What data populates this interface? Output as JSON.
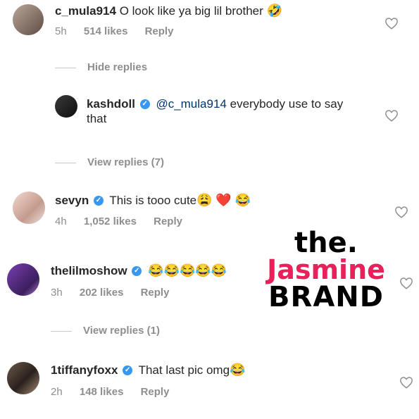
{
  "comments": [
    {
      "username": "c_mula914",
      "verified": false,
      "text": "O look like ya big lil brother",
      "emojis": [
        "🤣"
      ],
      "time": "5h",
      "likes": "514 likes",
      "reply": "Reply"
    },
    {
      "username": "kashdoll",
      "verified": true,
      "mention": "@c_mula914",
      "text_line1": "everybody use to say",
      "text_line2": "that"
    },
    {
      "username": "sevyn",
      "verified": true,
      "text": "This is tooo cute",
      "emojis": [
        "😩",
        "❤️",
        "😂"
      ],
      "time": "4h",
      "likes": "1,052 likes",
      "reply": "Reply"
    },
    {
      "username": "thelilmoshow",
      "verified": true,
      "emojis": [
        "😂",
        "😂",
        "😂",
        "😂",
        "😂"
      ],
      "time": "3h",
      "likes": "202 likes",
      "reply": "Reply"
    },
    {
      "username": "1tiffanyfoxx",
      "verified": true,
      "text": "That last pic omg",
      "emojis": [
        "😂"
      ],
      "time": "2h",
      "likes": "148 likes",
      "reply": "Reply"
    }
  ],
  "toggles": {
    "hide_replies": "Hide replies",
    "view_replies_1": "View replies (7)",
    "view_replies_2": "View replies (1)"
  },
  "watermark": {
    "the": "the.",
    "jasmine": "Jasmine",
    "brand": "BRAND"
  },
  "colors": {
    "verified": "#3897f0",
    "mention": "#003569",
    "meta": "#8e8e8e",
    "watermark_pink": "#e8215a"
  },
  "icons": {
    "like": "heart-outline-icon",
    "verified": "verified-badge-icon"
  }
}
